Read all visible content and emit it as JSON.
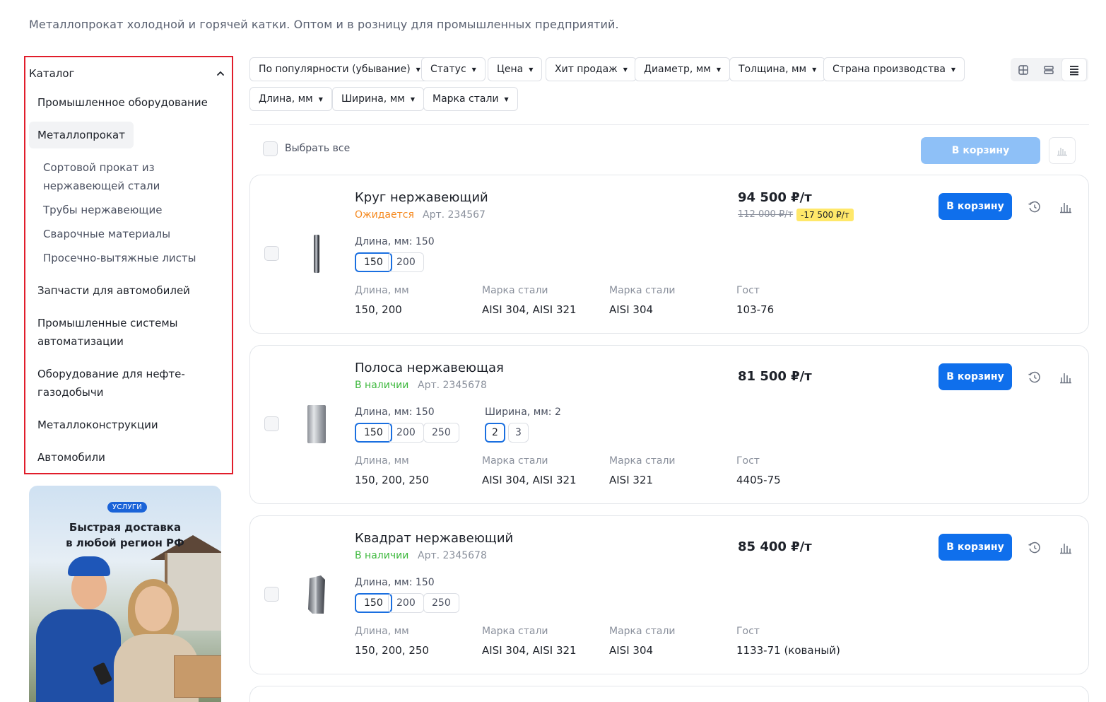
{
  "page": {
    "subtitle": "Металлопрокат холодной и горячей катки. Оптом и в розницу для промышленных предприятий."
  },
  "sidebar": {
    "title": "Каталог",
    "items": [
      {
        "label": "Промышленное оборудование"
      },
      {
        "label": "Металлопрокат",
        "active": true
      },
      {
        "label": "Запчасти для автомобилей"
      },
      {
        "label": "Промышленные системы автоматизации"
      },
      {
        "label": "Оборудование для нефте-газодобычи"
      },
      {
        "label": "Металлоконструкции"
      },
      {
        "label": "Автомобили"
      }
    ],
    "sub_items": [
      {
        "label": "Сортовой прокат из нержавеющей стали"
      },
      {
        "label": "Трубы нержавеющие"
      },
      {
        "label": "Сварочные материалы"
      },
      {
        "label": "Просечно-вытяжные листы"
      }
    ]
  },
  "promo": {
    "badge": "УСЛУГИ",
    "title_line1": "Быстрая доставка",
    "title_line2": "в любой регион РФ"
  },
  "filters": [
    {
      "label": "По популярности (убывание)"
    },
    {
      "label": "Статус"
    },
    {
      "label": "Цена"
    },
    {
      "label": "Хит продаж"
    },
    {
      "label": "Диаметр, мм"
    },
    {
      "label": "Толщина, мм"
    },
    {
      "label": "Страна производства"
    },
    {
      "label": "Длина, мм"
    },
    {
      "label": "Ширина, мм"
    },
    {
      "label": "Марка стали"
    }
  ],
  "view_modes": {
    "selected": "list-view"
  },
  "toolbar": {
    "select_all": "Выбрать все",
    "cart_all": "В корзину"
  },
  "products": [
    {
      "name": "Круг нержавеющий",
      "status": "Ожидается",
      "status_color": "#f5891f",
      "article": "Арт. 234567",
      "price": "94 500 ₽/т",
      "old_price": "112 000 ₽/т",
      "discount": "-17 500 ₽/т",
      "option_groups": [
        {
          "label": "Длина, мм: 150",
          "values": [
            "150",
            "200"
          ],
          "selected": "150"
        }
      ],
      "attributes": [
        {
          "label": "Длина, мм",
          "value": "150, 200"
        },
        {
          "label": "Марка стали",
          "value": "AISI 304, AISI 321"
        },
        {
          "label": "Марка стали",
          "value": "AISI 304"
        },
        {
          "label": "Гост",
          "value": "103-76"
        }
      ],
      "cart": "В корзину"
    },
    {
      "name": "Полоса нержавеющая",
      "status": "В наличии",
      "status_color": "#3cb83c",
      "article": "Арт. 2345678",
      "price": "81 500 ₽/т",
      "option_groups": [
        {
          "label": "Длина, мм: 150",
          "values": [
            "150",
            "200",
            "250"
          ],
          "selected": "150"
        },
        {
          "label": "Ширина, мм: 2",
          "values": [
            "2",
            "3"
          ],
          "selected": "2"
        }
      ],
      "attributes": [
        {
          "label": "Длина, мм",
          "value": "150, 200, 250"
        },
        {
          "label": "Марка стали",
          "value": "AISI 304, AISI 321"
        },
        {
          "label": "Марка стали",
          "value": "AISI 321"
        },
        {
          "label": "Гост",
          "value": "4405-75"
        }
      ],
      "cart": "В корзину"
    },
    {
      "name": "Квадрат нержавеющий",
      "status": "В наличии",
      "status_color": "#3cb83c",
      "article": "Арт. 2345678",
      "price": "85 400 ₽/т",
      "option_groups": [
        {
          "label": "Длина, мм: 150",
          "values": [
            "150",
            "200",
            "250"
          ],
          "selected": "150"
        }
      ],
      "attributes": [
        {
          "label": "Длина, мм",
          "value": "150, 200, 250"
        },
        {
          "label": "Марка стали",
          "value": "AISI 304, AISI 321"
        },
        {
          "label": "Марка стали",
          "value": "AISI 304"
        },
        {
          "label": "Гост",
          "value": "1133-71 (кованый)"
        }
      ],
      "cart": "В корзину"
    }
  ],
  "colors": {
    "accent": "#0f6fec",
    "accent_disabled": "#8ec0f7",
    "highlight_border": "#e11d2b",
    "discount_bg": "#ffe86a"
  }
}
